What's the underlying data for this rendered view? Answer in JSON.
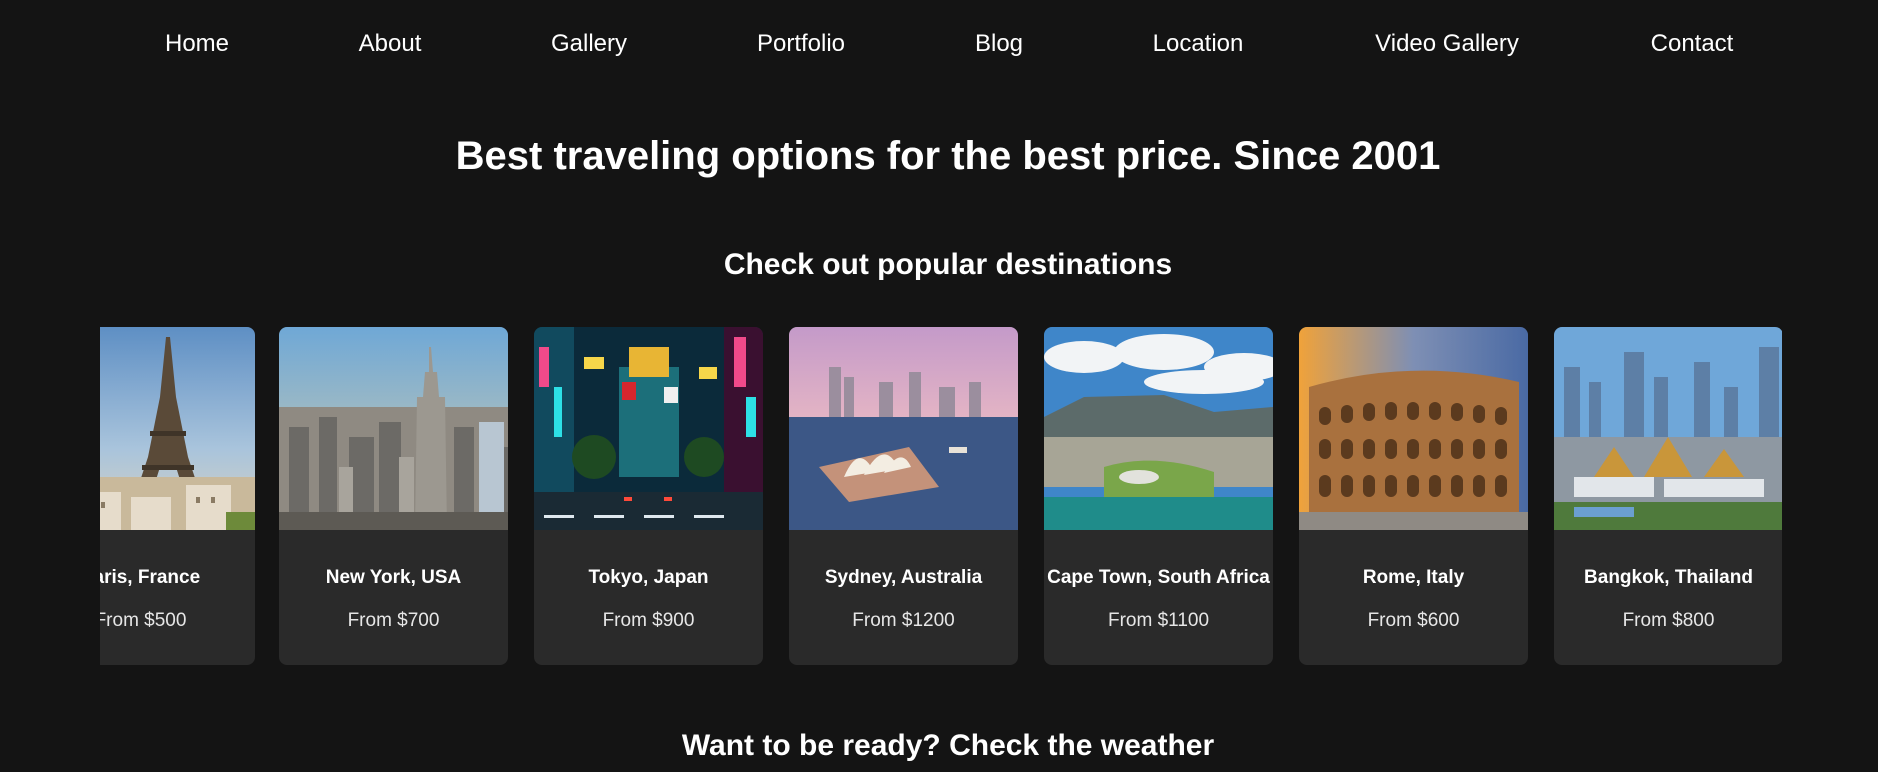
{
  "nav": {
    "items": [
      "Home",
      "About",
      "Gallery",
      "Portfolio",
      "Blog",
      "Location",
      "Video Gallery",
      "Contact"
    ]
  },
  "hero": {
    "title": "Best traveling options for the best price. Since 2001"
  },
  "destinations": {
    "heading": "Check out popular destinations",
    "cards": [
      {
        "city": "Paris, France",
        "price": "From $500",
        "image": "eiffel-tower-photo"
      },
      {
        "city": "New York, USA",
        "price": "From $700",
        "image": "new-york-skyline-photo"
      },
      {
        "city": "Tokyo, Japan",
        "price": "From $900",
        "image": "tokyo-shibuya-night-photo"
      },
      {
        "city": "Sydney, Australia",
        "price": "From $1200",
        "image": "sydney-opera-house-photo"
      },
      {
        "city": "Cape Town, South Africa",
        "price": "From $1100",
        "image": "table-mountain-photo"
      },
      {
        "city": "Rome, Italy",
        "price": "From $600",
        "image": "colosseum-photo"
      },
      {
        "city": "Bangkok, Thailand",
        "price": "From $800",
        "image": "bangkok-skyline-photo"
      }
    ]
  },
  "weather": {
    "heading": "Want to be ready? Check the weather"
  },
  "colors": {
    "background": "#141414",
    "card": "#2a2a2a",
    "text": "#ffffff"
  }
}
